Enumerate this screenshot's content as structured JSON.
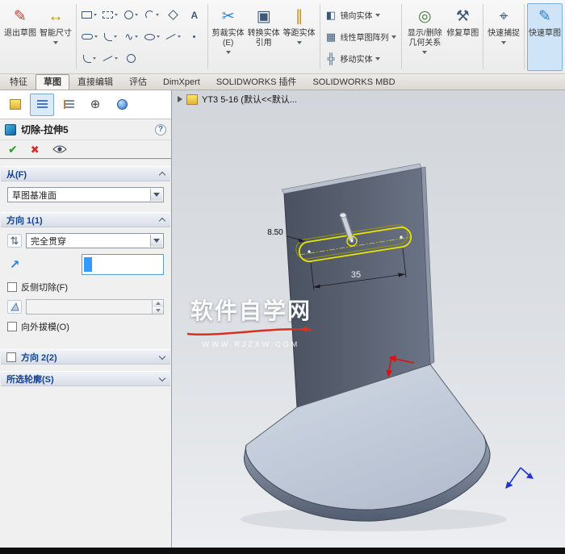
{
  "ribbon": {
    "exit_sketch": "退出草图",
    "smart_dimension": "智能尺寸",
    "text_tool": "A",
    "trim": "剪裁实体(E)",
    "convert": "转换实体引用",
    "offset": "等距实体",
    "mirror": "镜向实体",
    "linear_pattern": "线性草图阵列",
    "move": "移动实体",
    "relations": "显示/删除几何关系",
    "repair": "修复草图",
    "quick_snaps": "快速捕捉",
    "rapid_sketch": "快速草图"
  },
  "ribbon_icons": {
    "exit_sketch": "✎",
    "smart_dimension": "↔",
    "trim": "✂",
    "convert": "▣",
    "offset": "∥",
    "mirror": "◧",
    "linear_pattern": "▦",
    "move": "╬",
    "relations": "◎",
    "repair": "⚒",
    "quick_snaps": "⌖",
    "rapid_sketch": "✎",
    "spline": "∿"
  },
  "tabs": {
    "items": [
      "特征",
      "草图",
      "直接编辑",
      "评估",
      "DimXpert",
      "SOLIDWORKS 插件",
      "SOLIDWORKS MBD"
    ],
    "active": "草图"
  },
  "panel": {
    "title": "切除-拉伸5",
    "from_label": "从(F)",
    "from_value": "草图基准面",
    "dir1_label": "方向 1(1)",
    "dir1_value": "完全贯穿",
    "flip_side_label": "反侧切除(F)",
    "draft_out_label": "向外拔模(O)",
    "dir2_label": "方向 2(2)",
    "contours_label": "所选轮廓(S)"
  },
  "icons": {
    "confirm": "✔",
    "cancel": "✖",
    "help": "?",
    "crosshair": "⊕",
    "reverse_direction": "⇅",
    "direction_ref": "↗"
  },
  "viewport": {
    "tree_item": "YT3 5-16  (默认<<默认...",
    "watermark_title": "软件自学网",
    "watermark_url": "WWW.RJZXW.COM",
    "dim_width": "35",
    "dim_radius": "8.50"
  },
  "colors": {
    "accent": "#2f7fd4",
    "sketch_yellow": "#e8e400",
    "origin_red": "#e01010",
    "triad_blue": "#2433cc",
    "plate": "#5c6474",
    "base": "#c2ccda"
  }
}
